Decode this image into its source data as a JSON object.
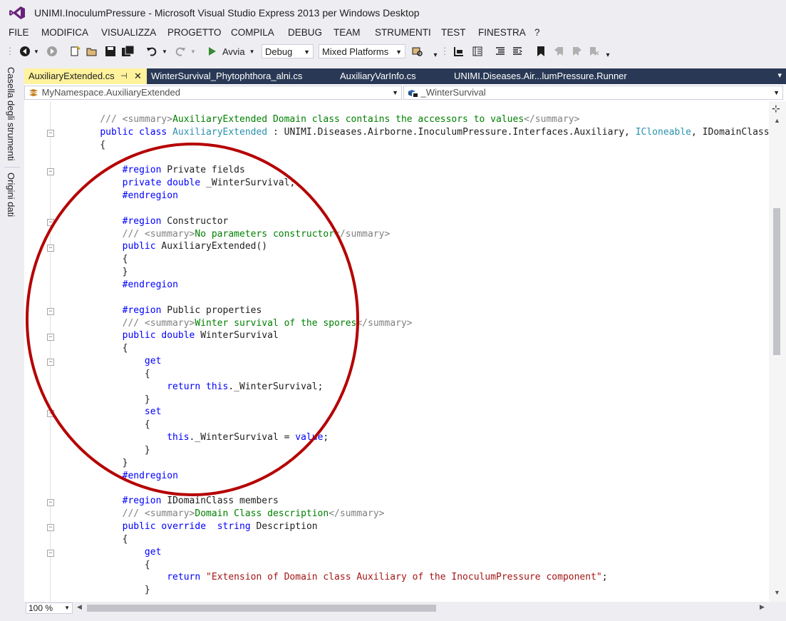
{
  "window": {
    "title": "UNIMI.InoculumPressure - Microsoft Visual Studio Express 2013 per Windows Desktop"
  },
  "menu": [
    "FILE",
    "MODIFICA",
    "VISUALIZZA",
    "PROGETTO",
    "COMPILA",
    "DEBUG",
    "TEAM",
    "STRUMENTI",
    "TEST",
    "FINESTRA",
    "?"
  ],
  "toolbar": {
    "start_label": "Avvia",
    "config_value": "Debug",
    "platform_value": "Mixed Platforms"
  },
  "side_tabs": [
    "Casella degli strumenti",
    "Origini dati"
  ],
  "tabs": [
    {
      "label": "AuxiliaryExtended.cs",
      "active": true
    },
    {
      "label": "WinterSurvival_Phytophthora_alni.cs",
      "active": false
    },
    {
      "label": "AuxiliaryVarInfo.cs",
      "active": false
    },
    {
      "label": "UNIMI.Diseases.Air...lumPressure.Runner",
      "active": false
    }
  ],
  "navbar": {
    "scope": "MyNamespace.AuxiliaryExtended",
    "member": "_WinterSurvival"
  },
  "status": {
    "zoom": "100 %"
  },
  "annotation": {
    "color": "#B50000"
  },
  "code_lines": [
    "    /// <summary>AuxiliaryExtended Domain class contains the accessors to values</summary>",
    "    public class AuxiliaryExtended : UNIMI.Diseases.Airborne.InoculumPressure.Interfaces.Auxiliary, ICloneable, IDomainClass",
    "    {",
    "",
    "        #region Private fields",
    "        private double _WinterSurvival;",
    "        #endregion",
    "",
    "        #region Constructor",
    "        /// <summary>No parameters constructor</summary>",
    "        public AuxiliaryExtended()",
    "        {",
    "        }",
    "        #endregion",
    "",
    "        #region Public properties",
    "        /// <summary>Winter survival of the spores</summary>",
    "        public double WinterSurvival",
    "        {",
    "            get",
    "            {",
    "                return this._WinterSurvival;",
    "            }",
    "            set",
    "            {",
    "                this._WinterSurvival = value;",
    "            }",
    "        }",
    "        #endregion",
    "",
    "        #region IDomainClass members",
    "        /// <summary>Domain Class description</summary>",
    "        public override  string Description",
    "        {",
    "            get",
    "            {",
    "                return \"Extension of Domain class Auxiliary of the InoculumPressure component\";",
    "            }"
  ]
}
